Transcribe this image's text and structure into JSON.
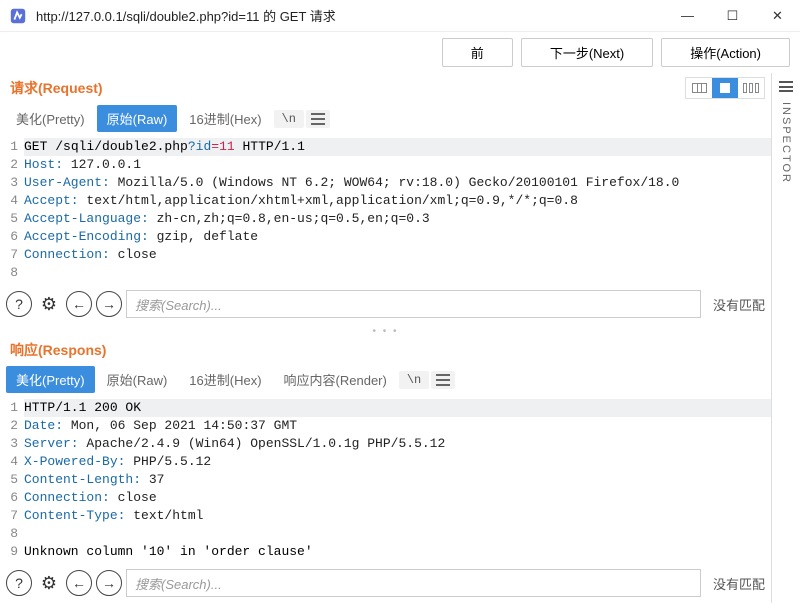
{
  "window": {
    "title": "http://127.0.0.1/sqli/double2.php?id=11 的 GET 请求"
  },
  "toolbar": {
    "prev": "前",
    "next": "下一步(Next)",
    "action": "操作(Action)"
  },
  "inspector_label": "INSPECTOR",
  "request": {
    "title": "请求(Request)",
    "tabs": {
      "pretty": "美化(Pretty)",
      "raw": "原始(Raw)",
      "hex": "16进制(Hex)",
      "nl": "\\n"
    },
    "lines": [
      {
        "type": "start",
        "method": "GET ",
        "path": "/sqli/double2.php",
        "q": "?",
        "k": "id",
        "eq": "=",
        "v": "11",
        "proto": " HTTP/1.1"
      },
      {
        "type": "hdr",
        "name": "Host:",
        "val": " 127.0.0.1"
      },
      {
        "type": "hdr",
        "name": "User-Agent:",
        "val": " Mozilla/5.0 (Windows NT 6.2; WOW64; rv:18.0) Gecko/20100101 Firefox/18.0"
      },
      {
        "type": "hdr",
        "name": "Accept:",
        "val": " text/html,application/xhtml+xml,application/xml;q=0.9,*/*;q=0.8"
      },
      {
        "type": "hdr",
        "name": "Accept-Language:",
        "val": " zh-cn,zh;q=0.8,en-us;q=0.5,en;q=0.3"
      },
      {
        "type": "hdr",
        "name": "Accept-Encoding:",
        "val": " gzip, deflate"
      },
      {
        "type": "hdr",
        "name": "Connection:",
        "val": " close"
      },
      {
        "type": "empty"
      }
    ],
    "search_placeholder": "搜索(Search)...",
    "nomatch": "没有匹配"
  },
  "response": {
    "title": "响应(Respons)",
    "tabs": {
      "pretty": "美化(Pretty)",
      "raw": "原始(Raw)",
      "hex": "16进制(Hex)",
      "render": "响应内容(Render)",
      "nl": "\\n"
    },
    "lines": [
      {
        "type": "status",
        "text": "HTTP/1.1 200 OK"
      },
      {
        "type": "hdr",
        "name": "Date:",
        "val": " Mon, 06 Sep 2021 14:50:37 GMT"
      },
      {
        "type": "hdr",
        "name": "Server:",
        "val": " Apache/2.4.9 (Win64) OpenSSL/1.0.1g PHP/5.5.12"
      },
      {
        "type": "hdr",
        "name": "X-Powered-By:",
        "val": " PHP/5.5.12"
      },
      {
        "type": "hdr",
        "name": "Content-Length:",
        "val": " 37"
      },
      {
        "type": "hdr",
        "name": "Connection:",
        "val": " close"
      },
      {
        "type": "hdr",
        "name": "Content-Type:",
        "val": " text/html"
      },
      {
        "type": "empty"
      },
      {
        "type": "body",
        "text": "Unknown column '10' in 'order clause'"
      }
    ],
    "search_placeholder": "搜索(Search)...",
    "nomatch": "没有匹配"
  },
  "icons": {
    "help": "?",
    "gear": "⚙",
    "back": "←",
    "fwd": "→",
    "min": "—",
    "max": "☐",
    "close": "✕"
  }
}
